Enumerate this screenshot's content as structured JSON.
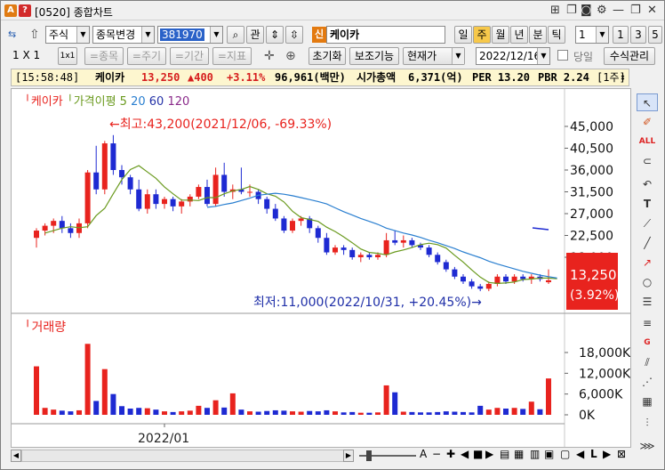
{
  "window": {
    "code": "[0520]",
    "title": "종합차트",
    "icon_a": "A",
    "icon_q": "?"
  },
  "toolbar": {
    "market": "주식",
    "change_stock": "종목변경",
    "stock_code": "381970",
    "gwan": "관",
    "stock_badge": "신",
    "stock_name": "케이카",
    "periods": [
      "일",
      "주",
      "월",
      "년",
      "분",
      "틱"
    ],
    "active_period": "주",
    "count_value": "1",
    "nums": [
      "1",
      "3",
      "5"
    ]
  },
  "toolbar2": {
    "ratio": "1 X 1",
    "ratio_btn": "1x1",
    "disabled": [
      "=종목",
      "=주기",
      "=기간",
      "=지표"
    ],
    "reset": "초기화",
    "aux": "보조기능",
    "current": "현재가",
    "date": "2022/12/16",
    "dangil": "당일",
    "formula": "수식관리"
  },
  "info": {
    "time": "[15:58:48]",
    "name": "케이카",
    "price": "13,250",
    "change": "▲400",
    "pct": "+3.11%",
    "volume": "96,961(백만)",
    "mcap_label": "시가총액",
    "mcap": "6,371(억)",
    "per": "PER 13.20",
    "pbr": "PBR 2.24",
    "unit": "[1주]"
  },
  "legend": {
    "name": "케이카",
    "ma_label": "가격이평",
    "ma": [
      "5",
      "20",
      "60",
      "120"
    ]
  },
  "annotations": {
    "high": "최고:43,200(2021/12/06, -69.33%)",
    "low": "최저:11,000(2022/10/31, +20.45%)"
  },
  "price_badge": {
    "price": "13,250",
    "pct": "(3.92%)"
  },
  "volume_label": "거래량",
  "x_label": "2022/01",
  "colors": {
    "up": "#e8231e",
    "down": "#1e2ad2",
    "ma5": "#6a9a1e",
    "ma20": "#2a7fd0",
    "ma60": "#2533a8",
    "ma120": "#8a2a8a",
    "badge": "#e8231e"
  },
  "chart_data": {
    "type": "candlestick",
    "price_ticks": [
      "45,000",
      "40,500",
      "36,000",
      "31,500",
      "27,000",
      "22,500",
      "18,000"
    ],
    "price_tick_values": [
      45000,
      40500,
      36000,
      31500,
      27000,
      22500,
      18000
    ],
    "volume_ticks": [
      "18,000K",
      "12,000K",
      "6,000K",
      "0K"
    ],
    "volume_tick_values": [
      18000,
      12000,
      6000,
      0
    ],
    "candles": [
      {
        "o": 22000,
        "h": 24000,
        "l": 20000,
        "c": 23500,
        "v": 14000
      },
      {
        "o": 23500,
        "h": 25000,
        "l": 22500,
        "c": 24500,
        "v": 2000
      },
      {
        "o": 24500,
        "h": 26000,
        "l": 23000,
        "c": 25500,
        "v": 1500
      },
      {
        "o": 25500,
        "h": 26500,
        "l": 23000,
        "c": 24000,
        "v": 1200
      },
      {
        "o": 24000,
        "h": 25000,
        "l": 22000,
        "c": 23000,
        "v": 1000
      },
      {
        "o": 23000,
        "h": 26000,
        "l": 22000,
        "c": 25000,
        "v": 1300
      },
      {
        "o": 25000,
        "h": 36000,
        "l": 24000,
        "c": 35500,
        "v": 20500
      },
      {
        "o": 35500,
        "h": 41000,
        "l": 31000,
        "c": 32000,
        "v": 4000
      },
      {
        "o": 32000,
        "h": 42000,
        "l": 31000,
        "c": 41500,
        "v": 13200
      },
      {
        "o": 41500,
        "h": 43200,
        "l": 35000,
        "c": 36000,
        "v": 6000
      },
      {
        "o": 36000,
        "h": 37000,
        "l": 33000,
        "c": 34500,
        "v": 2500
      },
      {
        "o": 34500,
        "h": 35000,
        "l": 31000,
        "c": 32000,
        "v": 1800
      },
      {
        "o": 32000,
        "h": 34000,
        "l": 27500,
        "c": 28000,
        "v": 2000
      },
      {
        "o": 28000,
        "h": 32000,
        "l": 27000,
        "c": 31000,
        "v": 1900
      },
      {
        "o": 31000,
        "h": 32000,
        "l": 28000,
        "c": 29000,
        "v": 1500
      },
      {
        "o": 29000,
        "h": 30500,
        "l": 28000,
        "c": 30000,
        "v": 1000
      },
      {
        "o": 30000,
        "h": 30500,
        "l": 27500,
        "c": 28500,
        "v": 800
      },
      {
        "o": 28500,
        "h": 30000,
        "l": 27000,
        "c": 29500,
        "v": 1000
      },
      {
        "o": 29500,
        "h": 31000,
        "l": 28500,
        "c": 30500,
        "v": 1200
      },
      {
        "o": 30500,
        "h": 33000,
        "l": 30000,
        "c": 32500,
        "v": 2600
      },
      {
        "o": 32500,
        "h": 34000,
        "l": 28500,
        "c": 29000,
        "v": 2000
      },
      {
        "o": 29000,
        "h": 36500,
        "l": 28500,
        "c": 35000,
        "v": 4200
      },
      {
        "o": 35000,
        "h": 37500,
        "l": 30500,
        "c": 31500,
        "v": 2100
      },
      {
        "o": 31500,
        "h": 33000,
        "l": 30000,
        "c": 32000,
        "v": 6200
      },
      {
        "o": 32000,
        "h": 36500,
        "l": 31000,
        "c": 31500,
        "v": 1500
      },
      {
        "o": 31500,
        "h": 33000,
        "l": 30500,
        "c": 31500,
        "v": 1000
      },
      {
        "o": 31500,
        "h": 32000,
        "l": 29000,
        "c": 30000,
        "v": 900
      },
      {
        "o": 30000,
        "h": 30500,
        "l": 27000,
        "c": 28000,
        "v": 1100
      },
      {
        "o": 28000,
        "h": 29000,
        "l": 25500,
        "c": 26000,
        "v": 1300
      },
      {
        "o": 26000,
        "h": 26500,
        "l": 23000,
        "c": 23500,
        "v": 1200
      },
      {
        "o": 23500,
        "h": 26000,
        "l": 23000,
        "c": 25500,
        "v": 1000
      },
      {
        "o": 25500,
        "h": 26500,
        "l": 24500,
        "c": 26000,
        "v": 900
      },
      {
        "o": 26000,
        "h": 26500,
        "l": 23000,
        "c": 24000,
        "v": 1100
      },
      {
        "o": 24000,
        "h": 24500,
        "l": 21000,
        "c": 22000,
        "v": 1000
      },
      {
        "o": 22000,
        "h": 23000,
        "l": 18500,
        "c": 19000,
        "v": 1300
      },
      {
        "o": 19000,
        "h": 20500,
        "l": 18500,
        "c": 20000,
        "v": 1000
      },
      {
        "o": 20000,
        "h": 20500,
        "l": 18500,
        "c": 19500,
        "v": 700
      },
      {
        "o": 19500,
        "h": 20000,
        "l": 17500,
        "c": 18000,
        "v": 800
      },
      {
        "o": 18000,
        "h": 19000,
        "l": 17000,
        "c": 18500,
        "v": 600
      },
      {
        "o": 18500,
        "h": 19000,
        "l": 17500,
        "c": 18000,
        "v": 600
      },
      {
        "o": 18000,
        "h": 19000,
        "l": 17500,
        "c": 18500,
        "v": 700
      },
      {
        "o": 18500,
        "h": 23000,
        "l": 18000,
        "c": 21500,
        "v": 8500
      },
      {
        "o": 21500,
        "h": 23500,
        "l": 20500,
        "c": 21000,
        "v": 6500
      },
      {
        "o": 21000,
        "h": 22500,
        "l": 20000,
        "c": 21500,
        "v": 900
      },
      {
        "o": 21500,
        "h": 22000,
        "l": 20000,
        "c": 20500,
        "v": 800
      },
      {
        "o": 20500,
        "h": 21000,
        "l": 19500,
        "c": 20000,
        "v": 700
      },
      {
        "o": 20000,
        "h": 20500,
        "l": 18000,
        "c": 18500,
        "v": 700
      },
      {
        "o": 18500,
        "h": 19000,
        "l": 16500,
        "c": 17000,
        "v": 800
      },
      {
        "o": 17000,
        "h": 17500,
        "l": 15000,
        "c": 15500,
        "v": 1000
      },
      {
        "o": 15500,
        "h": 16000,
        "l": 13500,
        "c": 14000,
        "v": 900
      },
      {
        "o": 14000,
        "h": 14500,
        "l": 12500,
        "c": 13000,
        "v": 800
      },
      {
        "o": 13000,
        "h": 13500,
        "l": 11500,
        "c": 12000,
        "v": 700
      },
      {
        "o": 12000,
        "h": 12500,
        "l": 11000,
        "c": 11500,
        "v": 2600
      },
      {
        "o": 11500,
        "h": 13000,
        "l": 11000,
        "c": 12500,
        "v": 1500
      },
      {
        "o": 12500,
        "h": 14500,
        "l": 12000,
        "c": 14000,
        "v": 2000
      },
      {
        "o": 14000,
        "h": 14500,
        "l": 12500,
        "c": 13000,
        "v": 1800
      },
      {
        "o": 13000,
        "h": 14500,
        "l": 12500,
        "c": 14000,
        "v": 2000
      },
      {
        "o": 14000,
        "h": 14500,
        "l": 13000,
        "c": 13500,
        "v": 1700
      },
      {
        "o": 13500,
        "h": 14500,
        "l": 12500,
        "c": 14000,
        "v": 3800
      },
      {
        "o": 14000,
        "h": 14500,
        "l": 13000,
        "c": 13500,
        "v": 1600
      },
      {
        "o": 12850,
        "h": 15500,
        "l": 12500,
        "c": 13250,
        "v": 10500
      }
    ],
    "ma5": [
      23000,
      23500,
      24000,
      24300,
      24100,
      24300,
      26600,
      28100,
      31100,
      34000,
      36100,
      36900,
      35600,
      34300,
      32500,
      31100,
      29800,
      29800,
      29700,
      30300,
      30300,
      31100,
      31700,
      32000,
      32600,
      32000,
      31100,
      30600,
      29400,
      27500,
      26200,
      25800,
      25400,
      24200,
      23300,
      22200,
      21000,
      19700,
      19000,
      18800,
      18500,
      19100,
      19500,
      20000,
      20600,
      20900,
      20600,
      19900,
      18400,
      17000,
      15400,
      13900,
      12800,
      12600,
      12700,
      12900,
      13400,
      13500,
      13700,
      13700,
      13550
    ],
    "ma20": [
      null,
      null,
      null,
      null,
      null,
      null,
      null,
      null,
      null,
      null,
      null,
      null,
      null,
      null,
      null,
      null,
      null,
      null,
      null,
      28300,
      28500,
      28900,
      29200,
      29700,
      30200,
      30800,
      31000,
      31200,
      31000,
      30700,
      30300,
      29900,
      29500,
      29000,
      28200,
      27400,
      26700,
      26000,
      25400,
      24800,
      24000,
      23500,
      23000,
      22600,
      22100,
      21500,
      21000,
      20400,
      19800,
      19100,
      18500,
      17900,
      17200,
      16600,
      16100,
      15600,
      15100,
      14700,
      14300,
      14000,
      13700
    ]
  },
  "icons": {
    "title_right": [
      "chart-settings-icon",
      "copy-icon",
      "save-icon",
      "camera-icon",
      "gear-icon",
      "restore-icon",
      "close-icon"
    ],
    "side": [
      "cursor-icon",
      "eraser-icon",
      "all-icon",
      "magnet-icon",
      "undo-icon",
      "text-icon",
      "line-icon",
      "trend-icon",
      "hline-icon",
      "vline-icon",
      "arrow-icon",
      "circle-icon",
      "fib-icon",
      "gann-icon",
      "pattern-icon",
      "speed-icon",
      "andrews-icon",
      "grid-icon",
      "more-icon"
    ]
  }
}
